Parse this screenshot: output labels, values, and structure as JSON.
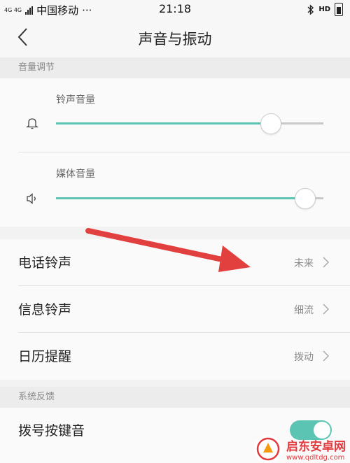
{
  "status_bar": {
    "network_tag": "4G 4G",
    "carrier": "中国移动",
    "dots": "···",
    "time": "21:18",
    "hd_label": "HD"
  },
  "header": {
    "title": "声音与振动"
  },
  "volume_section": {
    "label": "音量调节",
    "ringtone": {
      "label": "铃声音量",
      "level": 0.8
    },
    "media": {
      "label": "媒体音量",
      "level": 0.93
    }
  },
  "ringtone_rows": [
    {
      "label": "电话铃声",
      "value": "未来"
    },
    {
      "label": "信息铃声",
      "value": "细流"
    },
    {
      "label": "日历提醒",
      "value": "拨动"
    }
  ],
  "feedback_section": {
    "label": "系统反馈",
    "dial_tone": {
      "label": "拨号按键音",
      "enabled": true
    }
  },
  "watermark": {
    "name": "启东安卓网",
    "url": "www.qdltdg.com"
  },
  "colors": {
    "accent": "#5bc4b3",
    "arrow": "#e2403f"
  }
}
